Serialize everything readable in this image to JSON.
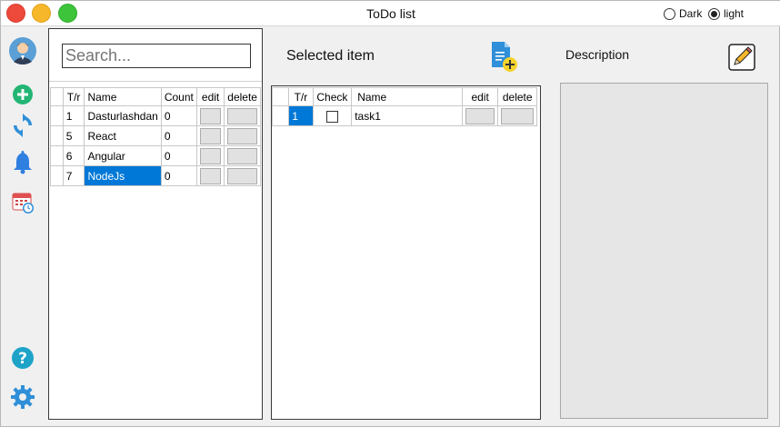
{
  "window": {
    "title": "ToDo list"
  },
  "theme": {
    "dark_label": "Dark",
    "light_label": "light",
    "selected": "light"
  },
  "sidebar": {
    "icons": [
      "avatar-icon",
      "add-icon",
      "refresh-icon",
      "bell-icon",
      "calendar-icon",
      "help-icon",
      "settings-icon"
    ]
  },
  "search": {
    "placeholder": "Search..."
  },
  "lists_table": {
    "headers": [
      "T/r",
      "Name",
      "Count",
      "edit",
      "delete"
    ],
    "rows": [
      {
        "num": "1",
        "name": "Dasturlashdan",
        "count": "0"
      },
      {
        "num": "5",
        "name": "React",
        "count": "0"
      },
      {
        "num": "6",
        "name": "Angular",
        "count": "0"
      },
      {
        "num": "7",
        "name": "NodeJs",
        "count": "0"
      }
    ],
    "selected_row": 3
  },
  "selected": {
    "heading": "Selected item",
    "headers": [
      "T/r",
      "Check",
      "Name",
      "edit",
      "delete"
    ],
    "rows": [
      {
        "num": "1",
        "checked": false,
        "name": "task1"
      }
    ]
  },
  "description": {
    "heading": "Description"
  },
  "colors": {
    "accent": "#0078d7",
    "close": "#ed4a3c",
    "minimize": "#f6b72a",
    "maximize": "#3ec43b"
  }
}
